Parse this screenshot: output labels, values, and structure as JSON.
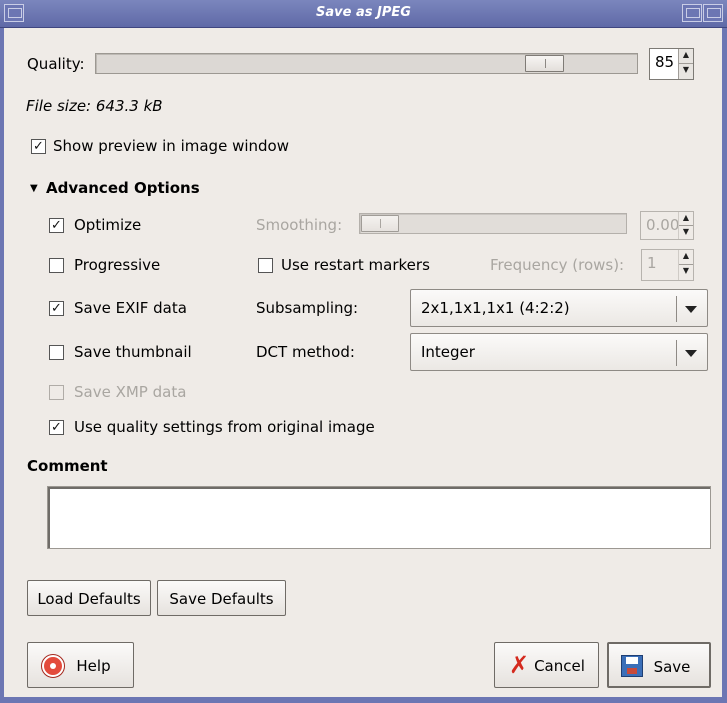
{
  "window": {
    "title": "Save as JPEG"
  },
  "quality": {
    "label": "Quality:",
    "value": "85",
    "slider_fraction": 0.85
  },
  "file_size": "File size: 643.3 kB",
  "show_preview": {
    "label": "Show preview in image window",
    "checked": true
  },
  "advanced": {
    "header": "Advanced Options",
    "optimize": {
      "label": "Optimize",
      "checked": true
    },
    "smoothing": {
      "label": "Smoothing:",
      "value": "0.00",
      "slider_fraction": 0.0
    },
    "progressive": {
      "label": "Progressive",
      "checked": false
    },
    "restart_markers": {
      "label": "Use restart markers",
      "checked": false
    },
    "frequency": {
      "label": "Frequency (rows):",
      "value": "1"
    },
    "save_exif": {
      "label": "Save EXIF data",
      "checked": true
    },
    "subsampling": {
      "label": "Subsampling:",
      "value": "2x1,1x1,1x1 (4:2:2)"
    },
    "save_thumbnail": {
      "label": "Save thumbnail",
      "checked": false
    },
    "dct_method": {
      "label": "DCT method:",
      "value": "Integer"
    },
    "save_xmp": {
      "label": "Save XMP data",
      "checked": false
    },
    "use_quality": {
      "label": "Use quality settings from original image",
      "checked": true
    }
  },
  "comment": {
    "label": "Comment",
    "value": ""
  },
  "buttons": {
    "load_defaults": "Load Defaults",
    "save_defaults": "Save Defaults",
    "help": "Help",
    "cancel": "Cancel",
    "save": "Save"
  },
  "icons": {
    "help": "help-lifebuoy-icon",
    "cancel": "cancel-x-icon",
    "save": "floppy-disk-icon",
    "expander": "triangle-down-icon"
  }
}
